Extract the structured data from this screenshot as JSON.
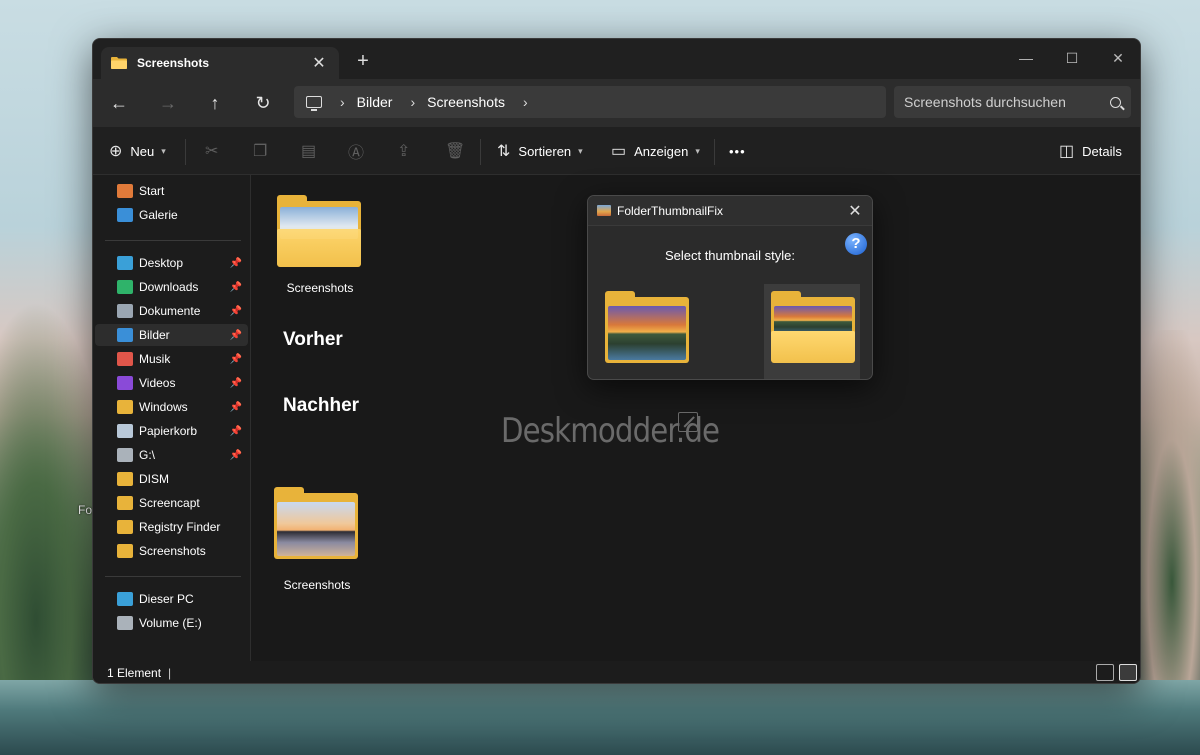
{
  "desktop": {
    "icon_label": "Fo"
  },
  "window": {
    "tab_title": "Screenshots",
    "new_tab": "+",
    "close_tab": "✕",
    "controls": {
      "minimize": "—",
      "maximize": "☐",
      "close": "✕"
    }
  },
  "nav": {
    "back": "←",
    "forward": "→",
    "up": "↑",
    "refresh": "↻",
    "breadcrumbs": [
      "Bilder",
      "Screenshots"
    ],
    "search_placeholder": "Screenshots durchsuchen"
  },
  "commandbar": {
    "new_label": "Neu",
    "sort_label": "Sortieren",
    "view_label": "Anzeigen",
    "more_label": "•••",
    "details_label": "Details"
  },
  "sidebar": {
    "top": [
      {
        "label": "Start",
        "icon": "home-icon",
        "color": "#e07a3a"
      },
      {
        "label": "Galerie",
        "icon": "gallery-icon",
        "color": "#3a8fd8"
      }
    ],
    "pinned": [
      {
        "label": "Desktop",
        "icon": "desktop-icon",
        "color": "#3aa0d8",
        "pinned": true
      },
      {
        "label": "Downloads",
        "icon": "download-icon",
        "color": "#2fb36a",
        "pinned": true
      },
      {
        "label": "Dokumente",
        "icon": "document-icon",
        "color": "#9aa6b2",
        "pinned": true
      },
      {
        "label": "Bilder",
        "icon": "pictures-icon",
        "color": "#3a8fd8",
        "pinned": true,
        "selected": true
      },
      {
        "label": "Musik",
        "icon": "music-icon",
        "color": "#e0564a",
        "pinned": true
      },
      {
        "label": "Videos",
        "icon": "video-icon",
        "color": "#8a4ad8",
        "pinned": true
      },
      {
        "label": "Windows",
        "icon": "folder-icon",
        "color": "#e8b33a",
        "pinned": true
      },
      {
        "label": "Papierkorb",
        "icon": "recycle-bin-icon",
        "color": "#b8c8d8",
        "pinned": true
      },
      {
        "label": "G:\\",
        "icon": "drive-icon",
        "color": "#aab2ba",
        "pinned": true
      },
      {
        "label": "DISM",
        "icon": "folder-icon",
        "color": "#e8b33a"
      },
      {
        "label": "Screencapt",
        "icon": "folder-icon",
        "color": "#e8b33a"
      },
      {
        "label": "Registry Finder",
        "icon": "folder-icon",
        "color": "#e8b33a"
      },
      {
        "label": "Screenshots",
        "icon": "folder-icon",
        "color": "#e8b33a"
      }
    ],
    "devices": [
      {
        "label": "Dieser PC",
        "icon": "pc-icon",
        "color": "#3aa0d8"
      },
      {
        "label": "Volume (E:)",
        "icon": "drive-icon",
        "color": "#aab2ba"
      }
    ]
  },
  "content": {
    "folder_top_label": "Screenshots",
    "vorher": "Vorher",
    "nachher": "Nachher",
    "folder_bottom_label": "Screenshots",
    "watermark": "Deskmodder.de"
  },
  "status": {
    "count": "1 Element",
    "sep": "|"
  },
  "dialog": {
    "title": "FolderThumbnailFix",
    "close": "✕",
    "help": "?",
    "prompt": "Select thumbnail style:",
    "selected_option": 2
  }
}
